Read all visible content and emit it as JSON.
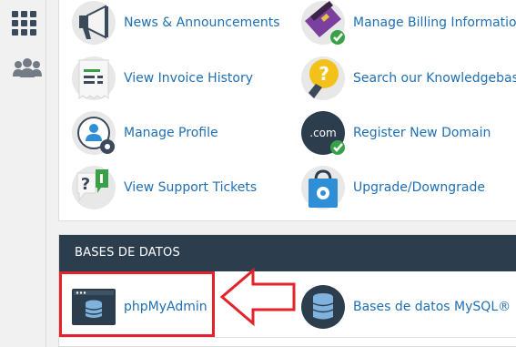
{
  "sidebar": {
    "items": [
      {
        "icon": "apps-grid-icon"
      },
      {
        "icon": "users-group-icon"
      }
    ]
  },
  "tools": {
    "items": [
      {
        "label": "News & Announcements",
        "icon": "megaphone-icon"
      },
      {
        "label": "Manage Billing Information",
        "icon": "credit-card-check-icon"
      },
      {
        "label": "View Invoice History",
        "icon": "invoice-document-icon"
      },
      {
        "label": "Search our Knowledgebase",
        "icon": "lightbulb-question-icon"
      },
      {
        "label": "Manage Profile",
        "icon": "user-gear-icon"
      },
      {
        "label": "Register New Domain",
        "icon": "dotcom-domain-icon"
      },
      {
        "label": "View Support Tickets",
        "icon": "support-ticket-icon"
      },
      {
        "label": "Upgrade/Downgrade",
        "icon": "shopping-bag-gear-icon"
      }
    ]
  },
  "databases": {
    "title": "BASES DE DATOS",
    "items": [
      {
        "label": "phpMyAdmin",
        "icon": "phpmyadmin-window-icon"
      },
      {
        "label": "Bases de datos MySQL®",
        "icon": "mysql-database-icon"
      }
    ]
  },
  "annotation": {
    "color": "#e3232b",
    "icon": "left-arrow-outline-icon"
  },
  "colors": {
    "link": "#1f6fb2",
    "header_bg": "#2c3e4e",
    "page_bg": "#f1f1f1"
  }
}
